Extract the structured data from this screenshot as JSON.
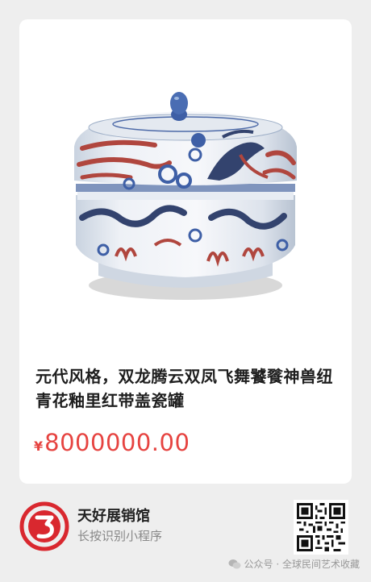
{
  "product": {
    "title": "元代风格，双龙腾云双凤飞舞饕餮神兽纽青花釉里红带盖瓷罐",
    "price_symbol": "¥",
    "price": "8000000.00"
  },
  "shop": {
    "name": "天好展销馆",
    "hint": "长按识别小程序",
    "logo_icon": "shop-logo-icon"
  },
  "watermark": {
    "text": "公众号 · 全球民间艺术收藏",
    "icon": "wechat-icon"
  },
  "colors": {
    "price": "#e64340",
    "background": "#eeeeee",
    "logo_red": "#d9282f"
  }
}
